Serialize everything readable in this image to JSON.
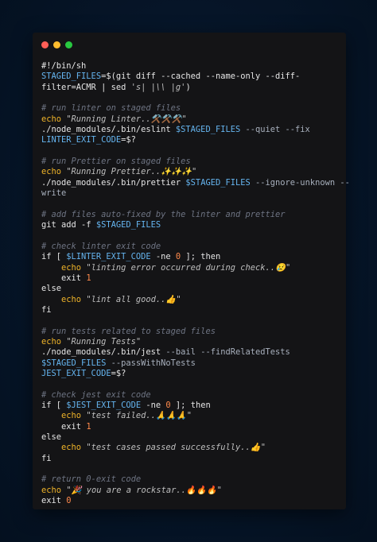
{
  "window": {
    "controls": [
      "close",
      "minimize",
      "maximize"
    ],
    "colors": {
      "close": "#ff5f57",
      "minimize": "#febc2e",
      "maximize": "#28c840",
      "background": "#141416"
    }
  },
  "code": {
    "lines": [
      [
        {
          "t": "#!/bin/sh",
          "c": "w"
        }
      ],
      [
        {
          "t": "STAGED_FILES",
          "c": "b"
        },
        {
          "t": "=$(git diff --cached --name-only --diff-",
          "c": "w"
        }
      ],
      [
        {
          "t": "filter=ACMR | sed ",
          "c": "w"
        },
        {
          "t": "'s| |\\\\ |g'",
          "c": "s"
        },
        {
          "t": ")",
          "c": "w"
        }
      ],
      [
        {
          "t": "",
          "c": "w"
        }
      ],
      [
        {
          "t": "# run linter on staged files",
          "c": "c"
        }
      ],
      [
        {
          "t": "echo ",
          "c": "y"
        },
        {
          "t": "\"Running Linter..⚒️⚒️⚒️\"",
          "c": "s"
        }
      ],
      [
        {
          "t": "./node_modules/.bin/eslint ",
          "c": "w"
        },
        {
          "t": "$STAGED_FILES",
          "c": "b"
        },
        {
          "t": " --quiet --fix",
          "c": "g"
        }
      ],
      [
        {
          "t": "LINTER_EXIT_CODE",
          "c": "b"
        },
        {
          "t": "=$?",
          "c": "w"
        }
      ],
      [
        {
          "t": "",
          "c": "w"
        }
      ],
      [
        {
          "t": "# run Prettier on staged files",
          "c": "c"
        }
      ],
      [
        {
          "t": "echo ",
          "c": "y"
        },
        {
          "t": "\"Running Prettier..✨✨✨\"",
          "c": "s"
        }
      ],
      [
        {
          "t": "./node_modules/.bin/prettier ",
          "c": "w"
        },
        {
          "t": "$STAGED_FILES",
          "c": "b"
        },
        {
          "t": " --ignore-unknown --",
          "c": "g"
        }
      ],
      [
        {
          "t": "write",
          "c": "g"
        }
      ],
      [
        {
          "t": "",
          "c": "w"
        }
      ],
      [
        {
          "t": "# add files auto-fixed by the linter and prettier",
          "c": "c"
        }
      ],
      [
        {
          "t": "git add -f ",
          "c": "w"
        },
        {
          "t": "$STAGED_FILES",
          "c": "b"
        }
      ],
      [
        {
          "t": "",
          "c": "w"
        }
      ],
      [
        {
          "t": "# check linter exit code",
          "c": "c"
        }
      ],
      [
        {
          "t": "if [ ",
          "c": "w"
        },
        {
          "t": "$LINTER_EXIT_CODE",
          "c": "b"
        },
        {
          "t": " -ne ",
          "c": "w"
        },
        {
          "t": "0",
          "c": "o"
        },
        {
          "t": " ]; then",
          "c": "w"
        }
      ],
      [
        {
          "t": "    echo ",
          "c": "y"
        },
        {
          "t": "\"linting error occurred during check..😢\"",
          "c": "s"
        }
      ],
      [
        {
          "t": "    exit ",
          "c": "w"
        },
        {
          "t": "1",
          "c": "o"
        }
      ],
      [
        {
          "t": "else",
          "c": "w"
        }
      ],
      [
        {
          "t": "    echo ",
          "c": "y"
        },
        {
          "t": "\"lint all good..👍\"",
          "c": "s"
        }
      ],
      [
        {
          "t": "fi",
          "c": "w"
        }
      ],
      [
        {
          "t": "",
          "c": "w"
        }
      ],
      [
        {
          "t": "# run tests related to staged files",
          "c": "c"
        }
      ],
      [
        {
          "t": "echo ",
          "c": "y"
        },
        {
          "t": "\"Running Tests\"",
          "c": "s"
        }
      ],
      [
        {
          "t": "./node_modules/.bin/jest ",
          "c": "w"
        },
        {
          "t": "--bail --findRelatedTests",
          "c": "g"
        }
      ],
      [
        {
          "t": "$STAGED_FILES",
          "c": "b"
        },
        {
          "t": " --passWithNoTests",
          "c": "g"
        }
      ],
      [
        {
          "t": "JEST_EXIT_CODE",
          "c": "b"
        },
        {
          "t": "=$?",
          "c": "w"
        }
      ],
      [
        {
          "t": "",
          "c": "w"
        }
      ],
      [
        {
          "t": "# check jest exit code",
          "c": "c"
        }
      ],
      [
        {
          "t": "if [ ",
          "c": "w"
        },
        {
          "t": "$JEST_EXIT_CODE",
          "c": "b"
        },
        {
          "t": " -ne ",
          "c": "w"
        },
        {
          "t": "0",
          "c": "o"
        },
        {
          "t": " ]; then",
          "c": "w"
        }
      ],
      [
        {
          "t": "    echo ",
          "c": "y"
        },
        {
          "t": "\"test failed..🙏🙏🙏\"",
          "c": "s"
        }
      ],
      [
        {
          "t": "    exit ",
          "c": "w"
        },
        {
          "t": "1",
          "c": "o"
        }
      ],
      [
        {
          "t": "else",
          "c": "w"
        }
      ],
      [
        {
          "t": "    echo ",
          "c": "y"
        },
        {
          "t": "\"test cases passed successfully..👍\"",
          "c": "s"
        }
      ],
      [
        {
          "t": "fi",
          "c": "w"
        }
      ],
      [
        {
          "t": "",
          "c": "w"
        }
      ],
      [
        {
          "t": "# return 0-exit code",
          "c": "c"
        }
      ],
      [
        {
          "t": "echo ",
          "c": "y"
        },
        {
          "t": "\"🎉 you are a rockstar..🔥🔥🔥\"",
          "c": "s"
        }
      ],
      [
        {
          "t": "exit ",
          "c": "w"
        },
        {
          "t": "0",
          "c": "o"
        }
      ]
    ]
  }
}
